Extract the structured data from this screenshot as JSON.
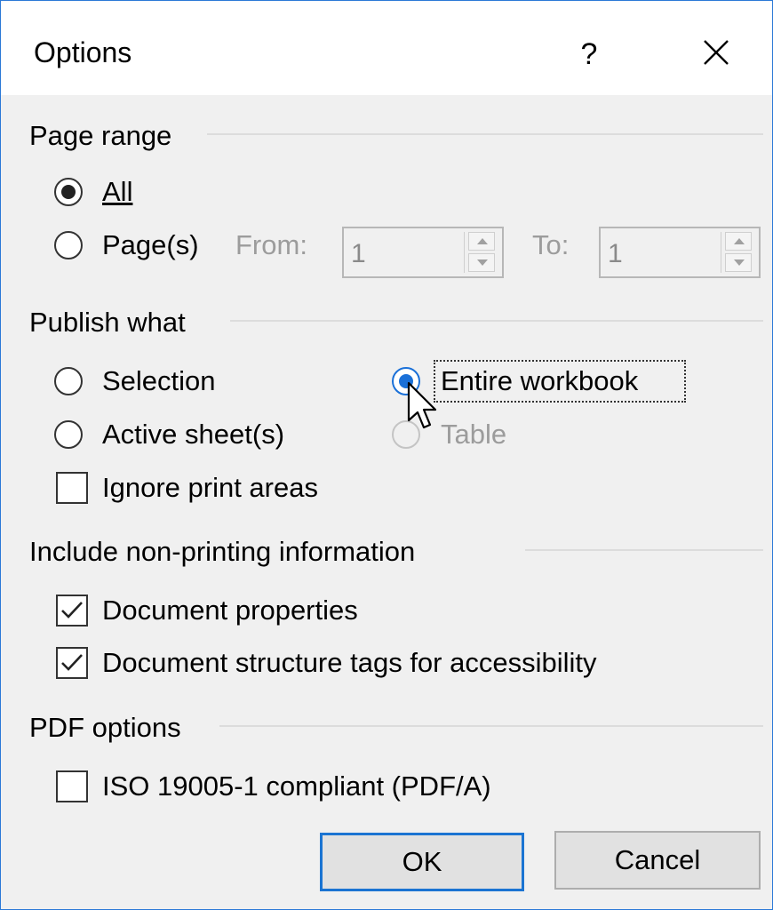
{
  "window": {
    "title": "Options",
    "help_glyph": "?",
    "close_icon": "close-icon"
  },
  "page_range": {
    "heading": "Page range",
    "all_label": "All",
    "pages_label": "Page(s)",
    "from_label": "From:",
    "from_value": "1",
    "to_label": "To:",
    "to_value": "1",
    "selected": "All"
  },
  "publish_what": {
    "heading": "Publish what",
    "selection_label": "Selection",
    "entire_workbook_label": "Entire workbook",
    "active_sheets_label": "Active sheet(s)",
    "table_label": "Table",
    "ignore_print_areas_label": "Ignore print areas",
    "selected": "Entire workbook",
    "ignore_print_areas_checked": false
  },
  "non_printing": {
    "heading": "Include non-printing information",
    "document_properties_label": "Document properties",
    "document_properties_checked": true,
    "structure_tags_label": "Document structure tags for accessibility",
    "structure_tags_checked": true
  },
  "pdf_options": {
    "heading": "PDF options",
    "iso_label": "ISO 19005-1 compliant (PDF/A)",
    "iso_checked": false
  },
  "buttons": {
    "ok_label": "OK",
    "cancel_label": "Cancel"
  },
  "colors": {
    "accent": "#1a70d8",
    "window_border": "#2b79d7",
    "background": "#f0f0f0"
  }
}
